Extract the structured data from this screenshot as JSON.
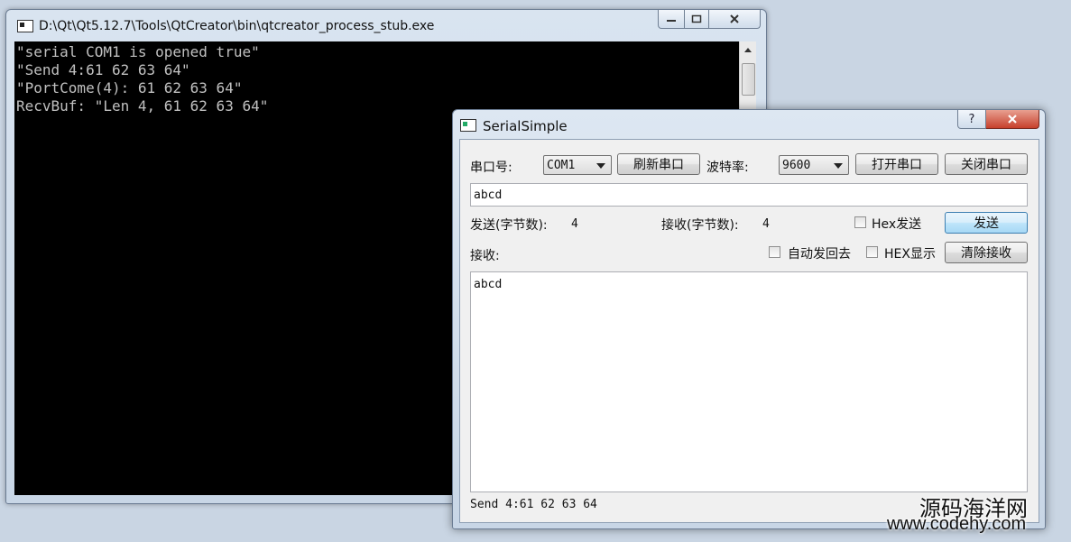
{
  "console": {
    "title": "D:\\Qt\\Qt5.12.7\\Tools\\QtCreator\\bin\\qtcreator_process_stub.exe",
    "lines": [
      "\"serial COM1 is opened true\"",
      "\"Send 4:61 62 63 64\"",
      "\"PortCome(4): 61 62 63 64\"",
      "RecvBuf: \"Len 4, 61 62 63 64\""
    ]
  },
  "dialog": {
    "title": "SerialSimple",
    "port_label": "串口号:",
    "port_value": "COM1",
    "refresh_button": "刷新串口",
    "baud_label": "波特率:",
    "baud_value": "9600",
    "open_button": "打开串口",
    "close_button": "关闭串口",
    "send_input_value": "abcd",
    "send_count_label": "发送(字节数):",
    "send_count": "4",
    "recv_count_label": "接收(字节数):",
    "recv_count": "4",
    "hex_send_label": "Hex发送",
    "send_button": "发送",
    "recv_label": "接收:",
    "auto_echo_label": "自动发回去",
    "hex_display_label": "HEX显示",
    "clear_button": "清除接收",
    "recv_text": "abcd",
    "status_text": "Send 4:61 62 63 64"
  },
  "watermark": {
    "cn": "源码海洋网",
    "url": "www.codehy.com"
  },
  "icons": {
    "console_app": "console-window-icon",
    "dialog_app": "qt-window-icon",
    "help": "help-icon",
    "close": "close-icon"
  }
}
